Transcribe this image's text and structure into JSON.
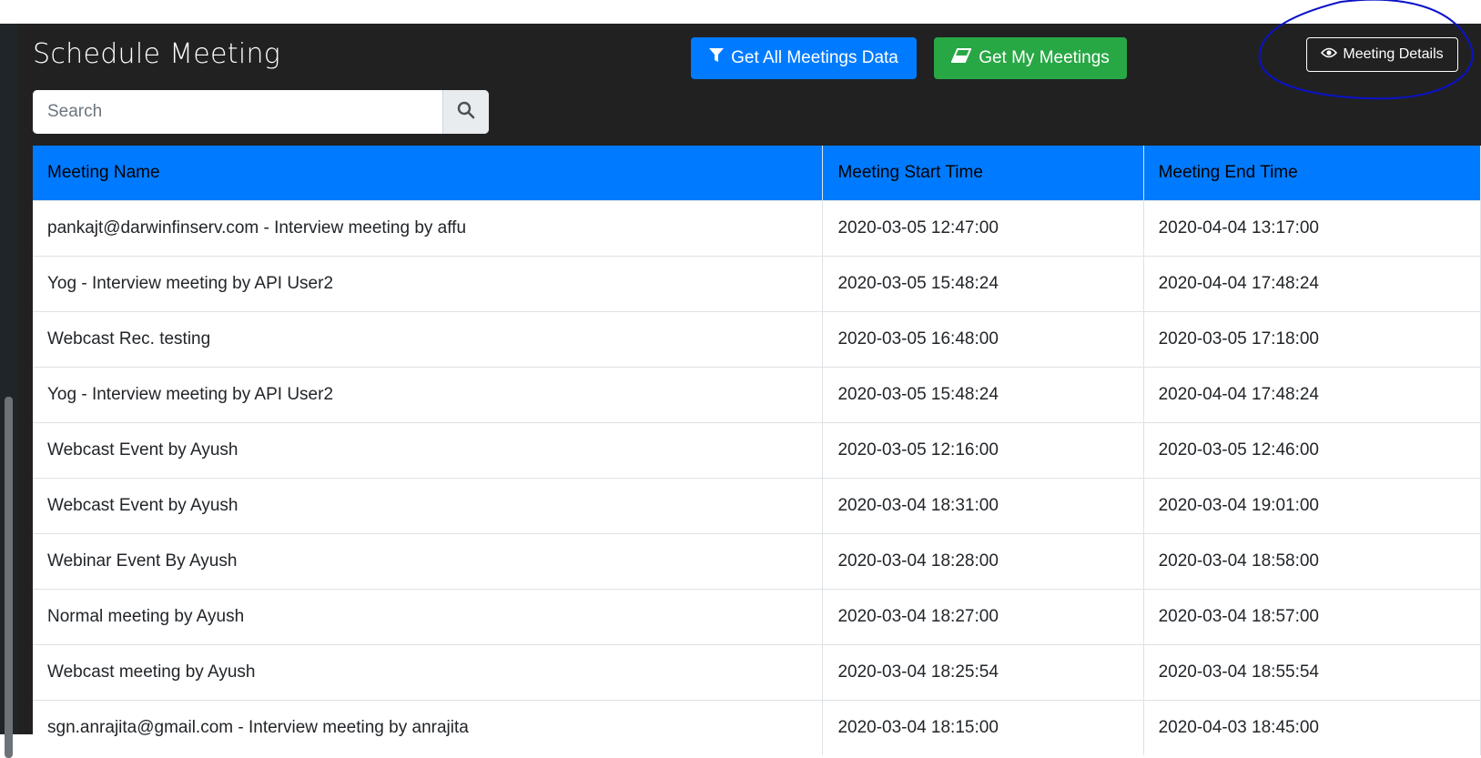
{
  "page": {
    "title": "Schedule Meeting"
  },
  "search": {
    "placeholder": "Search",
    "icon": "search-icon"
  },
  "toolbar": {
    "get_all_label": "Get All Meetings Data",
    "get_all_icon": "filter-icon",
    "get_mine_label": "Get My Meetings",
    "get_mine_icon": "eraser-icon",
    "details_label": "Meeting Details",
    "details_icon": "eye-icon"
  },
  "colors": {
    "panel_bg": "#212121",
    "primary": "#007bff",
    "success": "#28a745",
    "annotation": "#0a12c8"
  },
  "table": {
    "headers": [
      "Meeting Name",
      "Meeting Start Time",
      "Meeting End Time"
    ],
    "rows": [
      [
        "pankajt@darwinfinserv.com - Interview meeting by affu",
        "2020-03-05 12:47:00",
        "2020-04-04 13:17:00"
      ],
      [
        "Yog - Interview meeting by API User2",
        "2020-03-05 15:48:24",
        "2020-04-04 17:48:24"
      ],
      [
        "Webcast Rec. testing",
        "2020-03-05 16:48:00",
        "2020-03-05 17:18:00"
      ],
      [
        "Yog - Interview meeting by API User2",
        "2020-03-05 15:48:24",
        "2020-04-04 17:48:24"
      ],
      [
        "Webcast Event by Ayush",
        "2020-03-05 12:16:00",
        "2020-03-05 12:46:00"
      ],
      [
        "Webcast Event by Ayush",
        "2020-03-04 18:31:00",
        "2020-03-04 19:01:00"
      ],
      [
        "Webinar Event By Ayush",
        "2020-03-04 18:28:00",
        "2020-03-04 18:58:00"
      ],
      [
        "Normal meeting by Ayush",
        "2020-03-04 18:27:00",
        "2020-03-04 18:57:00"
      ],
      [
        "Webcast meeting by Ayush",
        "2020-03-04 18:25:54",
        "2020-03-04 18:55:54"
      ],
      [
        "sgn.anrajita@gmail.com - Interview meeting by anrajita",
        "2020-03-04 18:15:00",
        "2020-04-03 18:45:00"
      ]
    ]
  }
}
